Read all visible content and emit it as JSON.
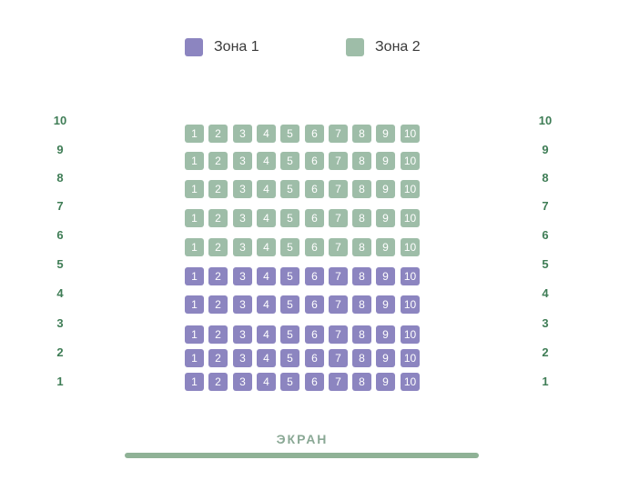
{
  "legend": {
    "zone1": {
      "label": "Зона 1",
      "color": "#8c85c0"
    },
    "zone2": {
      "label": "Зона 2",
      "color": "#9ebda8"
    }
  },
  "rows": [
    {
      "label": "10",
      "zone": "zone2",
      "seats": [
        "1",
        "2",
        "3",
        "4",
        "5",
        "6",
        "7",
        "8",
        "9",
        "10"
      ]
    },
    {
      "label": "9",
      "zone": "zone2",
      "seats": [
        "1",
        "2",
        "3",
        "4",
        "5",
        "6",
        "7",
        "8",
        "9",
        "10"
      ]
    },
    {
      "label": "8",
      "zone": "zone2",
      "seats": [
        "1",
        "2",
        "3",
        "4",
        "5",
        "6",
        "7",
        "8",
        "9",
        "10"
      ]
    },
    {
      "label": "7",
      "zone": "zone2",
      "seats": [
        "1",
        "2",
        "3",
        "4",
        "5",
        "6",
        "7",
        "8",
        "9",
        "10"
      ]
    },
    {
      "label": "6",
      "zone": "zone2",
      "seats": [
        "1",
        "2",
        "3",
        "4",
        "5",
        "6",
        "7",
        "8",
        "9",
        "10"
      ]
    },
    {
      "label": "5",
      "zone": "zone1",
      "seats": [
        "1",
        "2",
        "3",
        "4",
        "5",
        "6",
        "7",
        "8",
        "9",
        "10"
      ]
    },
    {
      "label": "4",
      "zone": "zone1",
      "seats": [
        "1",
        "2",
        "3",
        "4",
        "5",
        "6",
        "7",
        "8",
        "9",
        "10"
      ]
    },
    {
      "label": "3",
      "zone": "zone1",
      "seats": [
        "1",
        "2",
        "3",
        "4",
        "5",
        "6",
        "7",
        "8",
        "9",
        "10"
      ]
    },
    {
      "label": "2",
      "zone": "zone1",
      "seats": [
        "1",
        "2",
        "3",
        "4",
        "5",
        "6",
        "7",
        "8",
        "9",
        "10"
      ]
    },
    {
      "label": "1",
      "zone": "zone1",
      "seats": [
        "1",
        "2",
        "3",
        "4",
        "5",
        "6",
        "7",
        "8",
        "9",
        "10"
      ]
    }
  ],
  "screen": {
    "label": "ЭКРАН"
  }
}
